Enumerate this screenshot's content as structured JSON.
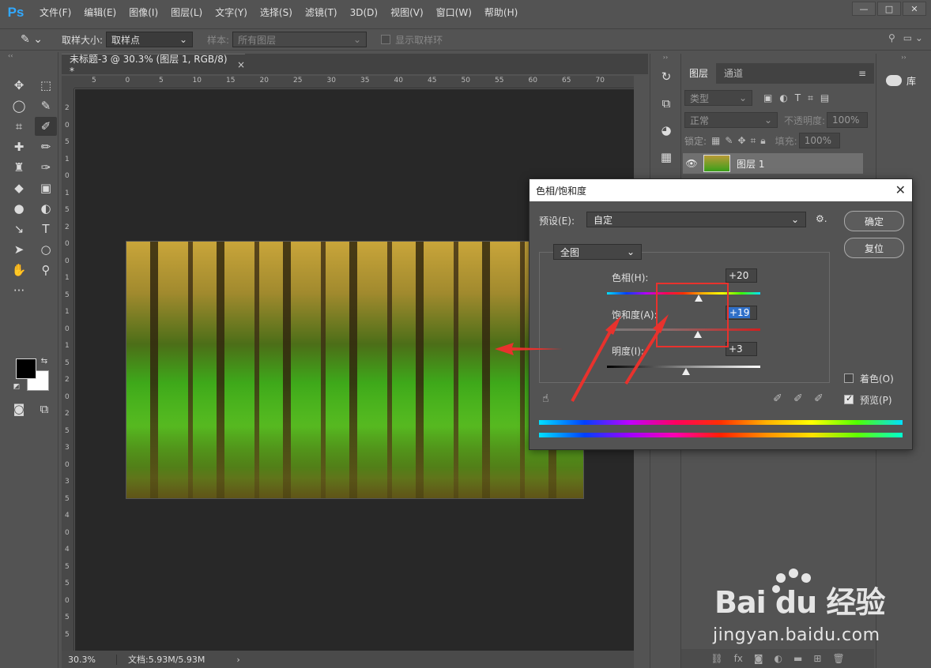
{
  "app": {
    "logo": "Ps",
    "menu": [
      "文件(F)",
      "编辑(E)",
      "图像(I)",
      "图层(L)",
      "文字(Y)",
      "选择(S)",
      "滤镜(T)",
      "3D(D)",
      "视图(V)",
      "窗口(W)",
      "帮助(H)"
    ],
    "window_controls": [
      "—",
      "□",
      "✕"
    ]
  },
  "options_bar": {
    "sample_size_label": "取样大小:",
    "sample_size_value": "取样点",
    "sample_label": "样本:",
    "sample_value": "所有图层",
    "show_ring_label": "显示取样环"
  },
  "document": {
    "tab_title": "未标题-3 @ 30.3% (图层 1, RGB/8) *",
    "tab_close": "×",
    "ruler_top": [
      "5",
      "0",
      "5",
      "10",
      "15",
      "20",
      "25",
      "30",
      "35",
      "40",
      "45",
      "50",
      "55",
      "60",
      "65",
      "70"
    ],
    "ruler_left": [
      "2",
      "0",
      "5",
      "1",
      "0",
      "1",
      "5",
      "2",
      "0",
      "0",
      "1",
      "5",
      "1",
      "0",
      "1",
      "5",
      "2",
      "0",
      "2",
      "5",
      "3",
      "0",
      "3",
      "5",
      "4",
      "0",
      "4",
      "5",
      "5",
      "0",
      "5",
      "5"
    ],
    "zoom": "30.3%",
    "doc_size": "文档:5.93M/5.93M",
    "status_arrow": "›"
  },
  "layers_panel": {
    "tabs": [
      "图层",
      "通道"
    ],
    "filter_label": "类型",
    "blend_mode": "正常",
    "opacity_label": "不透明度:",
    "opacity_value": "100%",
    "lock_label": "锁定:",
    "fill_label": "填充:",
    "fill_value": "100%",
    "layer_name": "图层 1"
  },
  "library_panel": {
    "label": "库"
  },
  "dialog": {
    "title": "色相/饱和度",
    "preset_label": "预设(E):",
    "preset_value": "自定",
    "channel_value": "全图",
    "hue_label": "色相(H):",
    "hue_value": "+20",
    "hue_fraction": 0.6,
    "saturation_label": "饱和度(A):",
    "saturation_value": "+19",
    "saturation_fraction": 0.595,
    "lightness_label": "明度(I):",
    "lightness_value": "+3",
    "lightness_fraction": 0.515,
    "ok_label": "确定",
    "reset_label": "复位",
    "colorize_label": "着色(O)",
    "colorize_checked": false,
    "preview_label": "预览(P)",
    "preview_checked": true
  },
  "watermark": {
    "brand": "Bai du 经验",
    "url": "jingyan.baidu.com"
  },
  "colors": {
    "annotation": "#e8322d",
    "accent": "#31a8ff"
  }
}
